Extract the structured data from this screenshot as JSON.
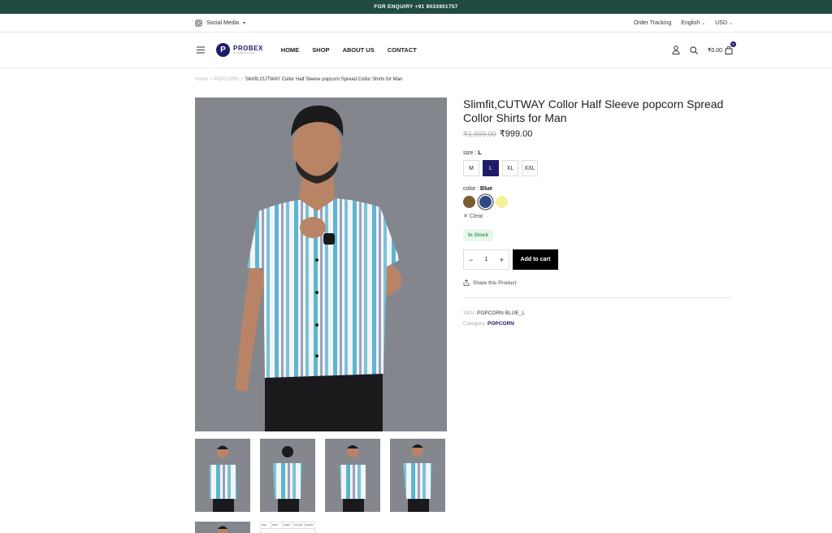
{
  "announcement": "FOR ENQUIRY +91 9033901757",
  "topbar": {
    "social_label": "Social Media",
    "order_tracking": "Order Tracking",
    "language": "English",
    "currency": "USD"
  },
  "header": {
    "logo_letter": "P",
    "logo_name": "PROBEX",
    "logo_tagline": "INTERNATIONAL",
    "nav": [
      "HOME",
      "SHOP",
      "ABOUT US",
      "CONTACT"
    ],
    "cart_total": "₹0.00",
    "cart_count": "0"
  },
  "breadcrumb": {
    "home": "Home",
    "sep": "/",
    "category": "POPCORN",
    "current": "Slimfit,CUTWAY Collor Half Sleeve popcorn Spread Collor Shirts for Man"
  },
  "product": {
    "title": "Slimfit,CUTWAY Collor Half Sleeve popcorn Spread Collor Shirts for Man",
    "old_price": "₹1,999.00",
    "price": "₹999.00",
    "size_label": "size :",
    "size_selected": "L",
    "sizes": [
      "M",
      "L",
      "XL",
      "XXL"
    ],
    "color_label": "color :",
    "color_selected": "Blue",
    "colors": [
      "#7a5c30",
      "#2b4a86",
      "#f5f099"
    ],
    "clear_label": "Clear",
    "stock": "In Stock",
    "quantity": "1",
    "add_to_cart": "Add to cart",
    "share": "Share this Product",
    "sku_label": "SKU:",
    "sku": "POPCORN BLUE_L",
    "category_label": "Category:",
    "category": "POPCORN"
  },
  "size_chart_headers": [
    "SIZE",
    "BODY",
    "CHEST",
    "COLLAR",
    "SLEEVE"
  ]
}
